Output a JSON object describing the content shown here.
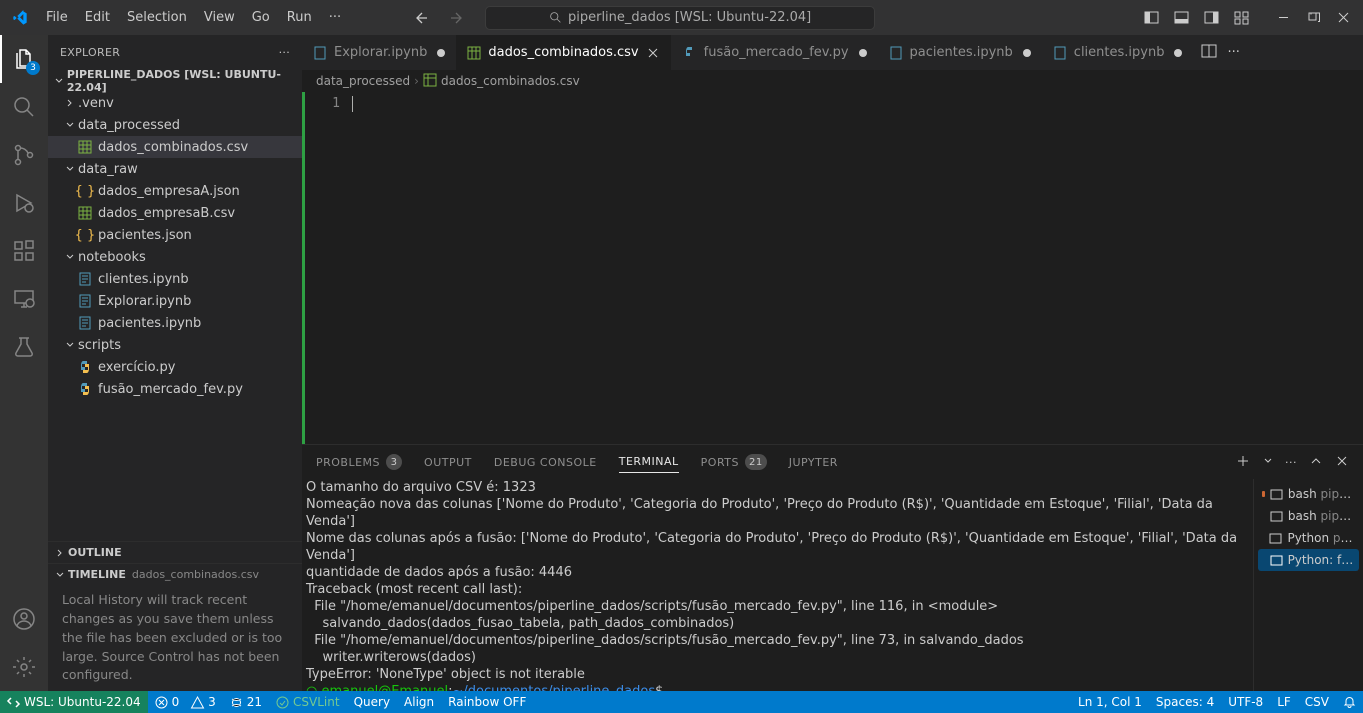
{
  "title": {
    "search": "piperline_dados [WSL: Ubuntu-22.04]"
  },
  "menu": {
    "file": "File",
    "edit": "Edit",
    "selection": "Selection",
    "view": "View",
    "go": "Go",
    "run": "Run"
  },
  "activitybar": {
    "explorer_badge": "3"
  },
  "sidebar": {
    "header": "EXPLORER",
    "root": "PIPERLINE_DADOS [WSL: UBUNTU-22.04]",
    "items": [
      {
        "label": ".venv",
        "type": "folder",
        "chev": "right"
      },
      {
        "label": "data_processed",
        "type": "folder",
        "chev": "down"
      },
      {
        "label": "dados_combinados.csv",
        "type": "csv"
      },
      {
        "label": "data_raw",
        "type": "folder",
        "chev": "down"
      },
      {
        "label": "dados_empresaA.json",
        "type": "json"
      },
      {
        "label": "dados_empresaB.csv",
        "type": "csv"
      },
      {
        "label": "pacientes.json",
        "type": "json"
      },
      {
        "label": "notebooks",
        "type": "folder",
        "chev": "down"
      },
      {
        "label": "clientes.ipynb",
        "type": "notebook"
      },
      {
        "label": "Explorar.ipynb",
        "type": "notebook"
      },
      {
        "label": "pacientes.ipynb",
        "type": "notebook"
      },
      {
        "label": "scripts",
        "type": "folder",
        "chev": "down"
      },
      {
        "label": "exercício.py",
        "type": "py"
      },
      {
        "label": "fusão_mercado_fev.py",
        "type": "py"
      }
    ],
    "outline": "OUTLINE",
    "timeline": "TIMELINE",
    "timeline_sub": "dados_combinados.csv",
    "timeline_body": "Local History will track recent changes as you save them unless the file has been excluded or is too large. Source Control has not been configured."
  },
  "tabs": [
    {
      "label": "Explorar.ipynb",
      "icon": "notebook",
      "dirty": true
    },
    {
      "label": "dados_combinados.csv",
      "icon": "csv",
      "active": true,
      "close": true
    },
    {
      "label": "fusão_mercado_fev.py",
      "icon": "py",
      "dirty": true
    },
    {
      "label": "pacientes.ipynb",
      "icon": "notebook",
      "dirty": true
    },
    {
      "label": "clientes.ipynb",
      "icon": "notebook",
      "dirty": true
    }
  ],
  "breadcrumb": {
    "seg1": "data_processed",
    "seg2": "dados_combinados.csv"
  },
  "gutter": {
    "line1": "1"
  },
  "panel": {
    "problems": "PROBLEMS",
    "problems_count": "3",
    "output": "OUTPUT",
    "debug": "DEBUG CONSOLE",
    "terminal": "TERMINAL",
    "ports": "PORTS",
    "ports_count": "21",
    "jupyter": "JUPYTER"
  },
  "terminal": {
    "l1": "O tamanho do arquivo CSV é: 1323",
    "l2": "Nomeação nova das colunas ['Nome do Produto', 'Categoria do Produto', 'Preço do Produto (R$)', 'Quantidade em Estoque', 'Filial', 'Data da Venda']",
    "l3": "Nome das colunas após a fusão: ['Nome do Produto', 'Categoria do Produto', 'Preço do Produto (R$)', 'Quantidade em Estoque', 'Filial', 'Data da Venda']",
    "l4": "quantidade de dados após a fusão: 4446",
    "l5": "Traceback (most recent call last):",
    "l6": "  File \"/home/emanuel/documentos/piperline_dados/scripts/fusão_mercado_fev.py\", line 116, in <module>",
    "l7": "    salvando_dados(dados_fusao_tabela, path_dados_combinados)",
    "l8": "  File \"/home/emanuel/documentos/piperline_dados/scripts/fusão_mercado_fev.py\", line 73, in salvando_dados",
    "l9": "    writer.writerows(dados)",
    "l10": "TypeError: 'NoneType' object is not iterable",
    "prompt_user": "emanuel@Emanuel",
    "prompt_path": "~/documentos/piperline_dados",
    "prompt_dollar": "$"
  },
  "termside": [
    {
      "label": "bash",
      "sub": "pipe..."
    },
    {
      "label": "bash",
      "sub": "pipe..."
    },
    {
      "label": "Python",
      "sub": "pipe..."
    },
    {
      "label": "Python: fus...",
      "sel": true
    }
  ],
  "status": {
    "remote": "WSL: Ubuntu-22.04",
    "errors": "0",
    "warnings": "3",
    "ports": "21",
    "csvlint": "CSVLint",
    "query": "Query",
    "align": "Align",
    "rainbow": "Rainbow OFF",
    "ln": "Ln 1, Col 1",
    "spaces": "Spaces: 4",
    "encoding": "UTF-8",
    "eol": "LF",
    "lang": "CSV"
  }
}
